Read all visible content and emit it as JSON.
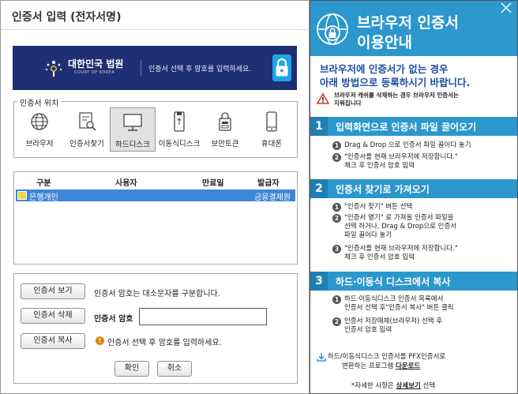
{
  "dialog": {
    "title": "인증서 입력 (전자서명)",
    "banner": {
      "brand": "대한민국 법원",
      "brand_sub": "COURT OF KOREA",
      "message": "인증서 선택 후 암호를 입력하세요."
    },
    "location": {
      "legend": "인증서 위치",
      "options": [
        {
          "label": "브라우저",
          "icon": "globe-icon"
        },
        {
          "label": "인증서찾기",
          "icon": "find-cert-icon"
        },
        {
          "label": "하드디스크",
          "icon": "monitor-icon",
          "selected": true
        },
        {
          "label": "이동식디스크",
          "icon": "usb-icon"
        },
        {
          "label": "보안토큰",
          "icon": "token-icon"
        },
        {
          "label": "휴대폰",
          "icon": "phone-icon"
        }
      ]
    },
    "table": {
      "columns": [
        "구분",
        "사용자",
        "만료일",
        "발급자"
      ],
      "rows": [
        {
          "type": "은행개인",
          "user": "",
          "expiry": "",
          "issuer": "금융결제원"
        }
      ]
    },
    "actions": {
      "view": "인증서 보기",
      "delete": "인증서 삭제",
      "copy": "인증서 복사",
      "case_hint": "인증서 암호는 대소문자를 구분합니다.",
      "pw_label": "인증서 암호",
      "pw_value": "",
      "select_hint": "인증서 선택 후 암호를 입력하세요."
    },
    "confirm": "확인",
    "cancel": "취소"
  },
  "panel": {
    "title_line1": "브라우저 인증서",
    "title_line2": "이용안내",
    "intro_line1": "브라우저에 인증서가 없는 경우",
    "intro_line2": "아래 방법으로 등록하시기 바랍니다.",
    "cache_warn_line1": "브라우저 캐쉬를 삭제하는 경우 브라우저 인증서는",
    "cache_warn_line2": "지워집니다",
    "sections": [
      {
        "num": "1",
        "title": "입력화면으로 인증서 파일 끌어오기",
        "steps": [
          [
            "Drag & Drop 으로 인증서 파일 끌어다 놓기"
          ],
          [
            "\"인증서를 현재 브라우저에 저장합니다.\"",
            "체크 후 인증서 암호 입력"
          ]
        ]
      },
      {
        "num": "2",
        "title": "인증서 찾기로 가져오기",
        "steps": [
          [
            "\"인증서 찾기\" 버튼 선택"
          ],
          [
            "\"인증서 열기\" 로 가져올 인증서 파일을",
            "선택 하거나, Drag & Drop으로 인증서",
            "파일 끌어다 놓기"
          ],
          [
            "\"인증서를 현재 브라우저에 저장합니다.\"",
            "체크 후 인증서 암호 입력"
          ]
        ]
      },
      {
        "num": "3",
        "title": "하드·이동식 디스크에서 복사",
        "steps": [
          [
            "하드·이동식디스크 인증서 목록에서",
            "인증서 선택 후\"인증서 복사\" 버튼 클릭"
          ],
          [
            "인증서 저장매체(브라우저) 선택 후",
            "인증서 암호 입력"
          ]
        ]
      }
    ],
    "download_line1": "하드/이동식디스크 인증서를 PFX인증서로",
    "download_line2_prefix": "변환하는 프로그램 ",
    "download_link": "다운로드",
    "detail_prefix": "*자세한 사항은 ",
    "detail_link": "상세보기",
    "detail_suffix": " 선택"
  },
  "colors": {
    "banner": "#1f2f73",
    "panel_accent": "#2c97cc",
    "selection": "#3e86d8",
    "intro_text": "#1f4ea1"
  }
}
